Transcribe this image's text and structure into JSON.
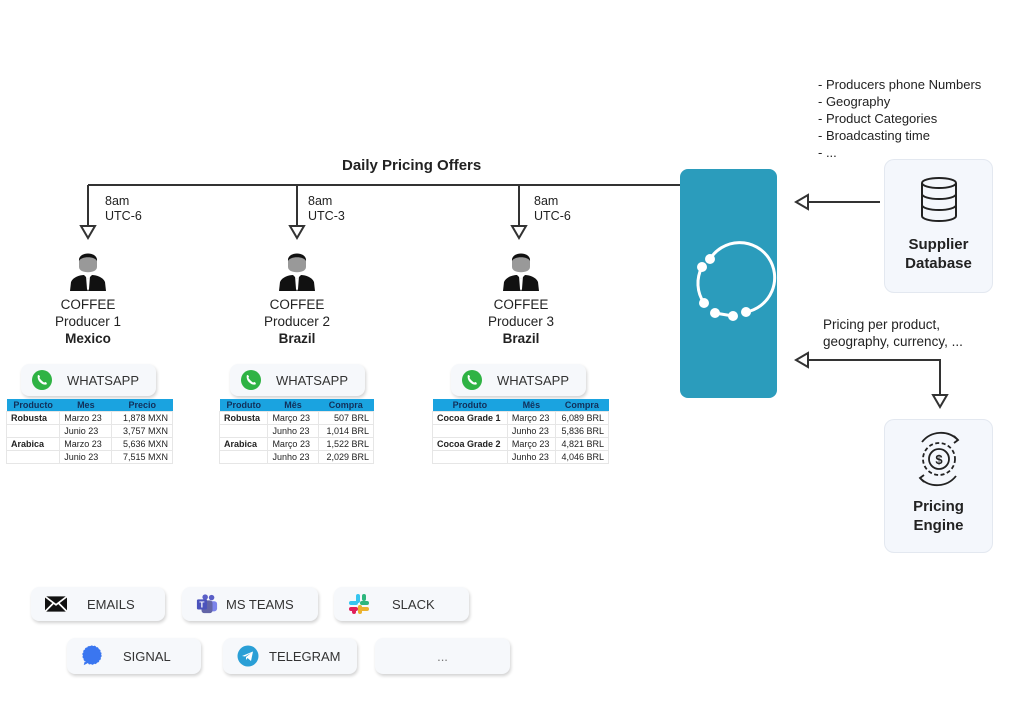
{
  "diagram": {
    "title": "Daily Pricing Offers",
    "database_notes": [
      "- Producers phone Numbers",
      "- Geography",
      "- Product Categories",
      "- Broadcasting time",
      "- ..."
    ],
    "pricing_note": [
      "Pricing per product,",
      "geography, currency, ..."
    ],
    "supplier_db": {
      "line1": "Supplier",
      "line2": "Database",
      "icon": "database-icon"
    },
    "pricing_engine": {
      "line1": "Pricing",
      "line2": "Engine",
      "icon": "gear-dollar-icon"
    },
    "hub_color": "#2b9cbc",
    "table_header_color": "#1aa3e0",
    "producers": [
      {
        "time": "8am",
        "tz": "UTC-6",
        "category": "COFFEE",
        "name": "Producer 1",
        "country": "Mexico",
        "channel": "WHATSAPP",
        "headers": [
          "Producto",
          "Mes",
          "Precio"
        ],
        "rows": [
          [
            "Robusta",
            "Marzo 23",
            "1,878 MXN"
          ],
          [
            "",
            "Junio 23",
            "3,757 MXN"
          ],
          [
            "Arabica",
            "Marzo 23",
            "5,636 MXN"
          ],
          [
            "",
            "Junio 23",
            "7,515 MXN"
          ]
        ]
      },
      {
        "time": "8am",
        "tz": "UTC-3",
        "category": "COFFEE",
        "name": "Producer 2",
        "country": "Brazil",
        "channel": "WHATSAPP",
        "headers": [
          "Produto",
          "Mês",
          "Compra"
        ],
        "rows": [
          [
            "Robusta",
            "Março 23",
            "507 BRL"
          ],
          [
            "",
            "Junho 23",
            "1,014 BRL"
          ],
          [
            "Arabica",
            "Março 23",
            "1,522 BRL"
          ],
          [
            "",
            "Junho 23",
            "2,029 BRL"
          ]
        ]
      },
      {
        "time": "8am",
        "tz": "UTC-6",
        "category": "COFFEE",
        "name": "Producer 3",
        "country": "Brazil",
        "channel": "WHATSAPP",
        "headers": [
          "Produto",
          "Mês",
          "Compra"
        ],
        "rows": [
          [
            "Cocoa Grade 1",
            "Março 23",
            "6,089 BRL"
          ],
          [
            "",
            "Junho 23",
            "5,836 BRL"
          ],
          [
            "Cocoa Grade 2",
            "Março 23",
            "4,821 BRL"
          ],
          [
            "",
            "Junho 23",
            "4,046 BRL"
          ]
        ]
      }
    ],
    "channels": [
      {
        "label": "EMAILS",
        "icon": "envelope-icon"
      },
      {
        "label": "MS TEAMS",
        "icon": "ms-teams-icon"
      },
      {
        "label": "SLACK",
        "icon": "slack-icon"
      },
      {
        "label": "SIGNAL",
        "icon": "signal-icon"
      },
      {
        "label": "TELEGRAM",
        "icon": "telegram-icon"
      },
      {
        "label": "...",
        "icon": ""
      }
    ]
  }
}
